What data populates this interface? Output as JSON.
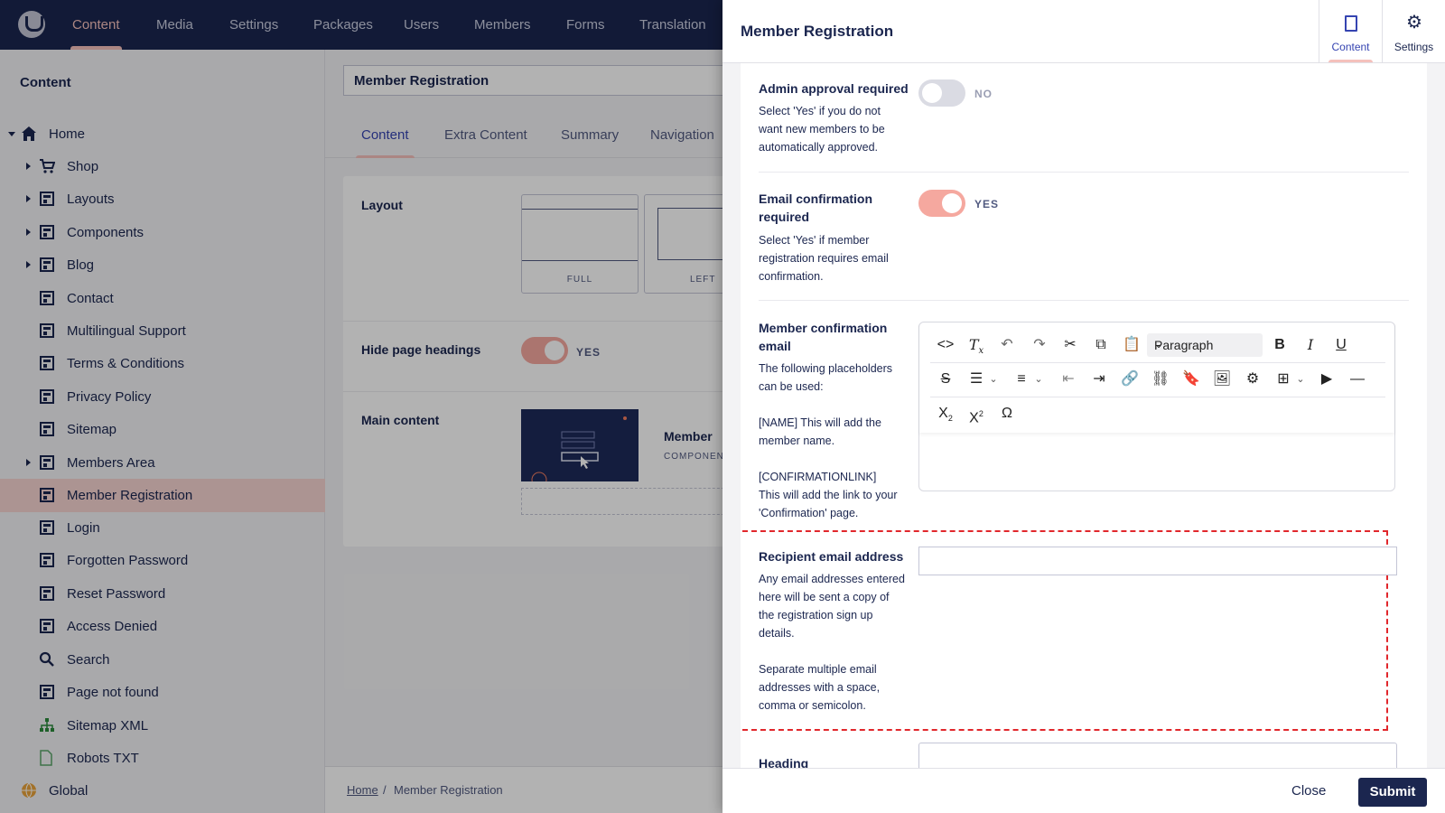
{
  "header": {
    "nav": [
      "Content",
      "Media",
      "Settings",
      "Packages",
      "Users",
      "Members",
      "Forms",
      "Translation"
    ],
    "active": "Content"
  },
  "tree": {
    "title": "Content",
    "items": [
      {
        "label": "Home",
        "icon": "home-icon",
        "expanded": true
      },
      {
        "label": "Shop",
        "icon": "cart-icon",
        "has_children": true
      },
      {
        "label": "Layouts",
        "icon": "page-icon",
        "has_children": true
      },
      {
        "label": "Components",
        "icon": "page-icon",
        "has_children": true
      },
      {
        "label": "Blog",
        "icon": "blog-icon",
        "has_children": true
      },
      {
        "label": "Contact",
        "icon": "page-icon"
      },
      {
        "label": "Multilingual Support",
        "icon": "page-icon"
      },
      {
        "label": "Terms & Conditions",
        "icon": "page-icon"
      },
      {
        "label": "Privacy Policy",
        "icon": "page-icon"
      },
      {
        "label": "Sitemap",
        "icon": "page-icon"
      },
      {
        "label": "Members Area",
        "icon": "members-page-icon",
        "has_children": true
      },
      {
        "label": "Member Registration",
        "icon": "page-icon",
        "selected": true
      },
      {
        "label": "Login",
        "icon": "page-icon"
      },
      {
        "label": "Forgotten Password",
        "icon": "page-icon"
      },
      {
        "label": "Reset Password",
        "icon": "page-icon"
      },
      {
        "label": "Access Denied",
        "icon": "page-icon"
      },
      {
        "label": "Search",
        "icon": "search-icon"
      },
      {
        "label": "Page not found",
        "icon": "page-icon"
      },
      {
        "label": "Sitemap XML",
        "icon": "sitemap-icon"
      },
      {
        "label": "Robots TXT",
        "icon": "document-icon"
      },
      {
        "label": "Global",
        "icon": "globe-icon"
      }
    ]
  },
  "editor": {
    "node_name": "Member Registration",
    "tabs": [
      "Content",
      "Extra Content",
      "Summary",
      "Navigation"
    ],
    "layout_label": "Layout",
    "layout_options": [
      "FULL",
      "LEFT"
    ],
    "hide_headings_label": "Hide page headings",
    "hide_headings_value": "YES",
    "main_content_label": "Main content",
    "block_name": "Member",
    "block_type": "COMPONEN"
  },
  "breadcrumb": {
    "home": "Home",
    "separator": "/",
    "current": "Member Registration"
  },
  "modal": {
    "title": "Member Registration",
    "tabs": [
      {
        "label": "Content",
        "icon": "document-icon",
        "active": true
      },
      {
        "label": "Settings",
        "icon": "gear-icon"
      }
    ],
    "admin_approval": {
      "label": "Admin approval required",
      "desc_lines": [
        "Select 'Yes' if you do not",
        "want new members to be",
        "automatically approved."
      ],
      "value": "NO"
    },
    "email_confirmation": {
      "label_lines": [
        "Email confirmation",
        "required"
      ],
      "desc_lines": [
        "Select 'Yes' if member",
        "registration requires email",
        "confirmation."
      ],
      "value": "YES"
    },
    "member_email": {
      "label_lines": [
        "Member confirmation",
        "email"
      ],
      "desc_lines": [
        "The following placeholders",
        "can be used:",
        "",
        "[NAME] This will add the",
        "member name.",
        "",
        "[CONFIRMATIONLINK]",
        "This will add the link to your",
        "'Confirmation' page."
      ],
      "format_select": "Paragraph"
    },
    "recipient": {
      "label": "Recipient email address",
      "desc_lines": [
        "Any email addresses entered",
        "here will be sent a copy of",
        "the registration sign up",
        "details.",
        "",
        "Separate multiple email",
        "addresses with a space,",
        "comma or semicolon."
      ],
      "value": ""
    },
    "next_label": "Heading",
    "close_label": "Close",
    "submit_label": "Submit"
  },
  "colors": {
    "header": "#1b264f",
    "accent": "#f5c1bc",
    "toggle_on": "#f5a89f",
    "highlight": "#e1272c"
  }
}
